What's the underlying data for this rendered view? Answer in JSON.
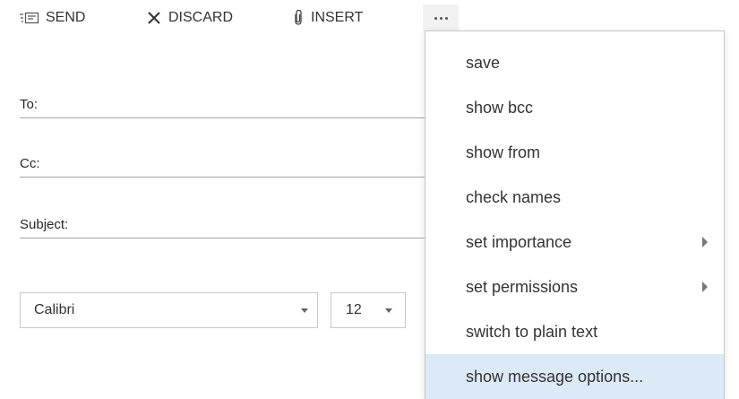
{
  "toolbar": {
    "send_label": "SEND",
    "discard_label": "DISCARD",
    "insert_label": "INSERT",
    "send_icon": "send-icon",
    "discard_icon": "close-icon",
    "insert_icon": "paperclip-icon",
    "more_icon": "more-ellipsis-icon"
  },
  "compose": {
    "to_label": "To:",
    "cc_label": "Cc:",
    "subject_label": "Subject:",
    "to_value": "",
    "cc_value": "",
    "subject_value": ""
  },
  "format": {
    "font_family": "Calibri",
    "font_size": "12"
  },
  "menu": {
    "items": [
      {
        "label": "save",
        "submenu": false
      },
      {
        "label": "show bcc",
        "submenu": false
      },
      {
        "label": "show from",
        "submenu": false
      },
      {
        "label": "check names",
        "submenu": false
      },
      {
        "label": "set importance",
        "submenu": true
      },
      {
        "label": "set permissions",
        "submenu": true
      },
      {
        "label": "switch to plain text",
        "submenu": false
      },
      {
        "label": "show message options...",
        "submenu": false
      }
    ],
    "highlighted_index": 7,
    "highlight_color": "#dce9f7"
  }
}
